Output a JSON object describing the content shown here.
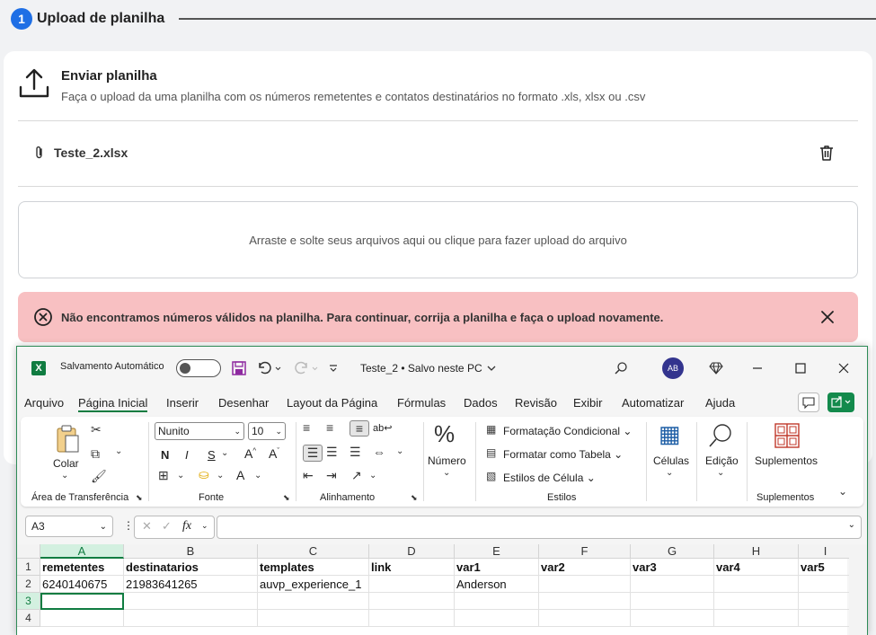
{
  "step": {
    "number": "1",
    "title": "Upload de planilha"
  },
  "upload": {
    "title": "Enviar planilha",
    "subtitle": "Faça o upload da uma planilha com os números remetentes e contatos destinatários no formato .xls, xlsx ou .csv",
    "file_name": "Teste_2.xlsx",
    "dropzone_text": "Arraste e solte seus arquivos aqui ou clique para fazer upload do arquivo"
  },
  "alert": {
    "text": "Não encontramos números válidos na planilha. Para continuar, corrija a planilha e faça o upload novamente.",
    "color": "#f8c0c2"
  },
  "excel": {
    "autosave_label": "Salvamento Automático",
    "doc_title": "Teste_2 • Salvo neste PC",
    "avatar_initials": "AB",
    "menu": [
      "Arquivo",
      "Página Inicial",
      "Inserir",
      "Desenhar",
      "Layout da Página",
      "Fórmulas",
      "Dados",
      "Revisão",
      "Exibir",
      "Automatizar",
      "Ajuda"
    ],
    "active_menu": "Página Inicial",
    "ribbon": {
      "clipboard": {
        "paste": "Colar",
        "group": "Área de Transferência"
      },
      "font": {
        "name": "Nunito",
        "size": "10",
        "bold": "N",
        "italic": "I",
        "underline": "S",
        "group": "Fonte"
      },
      "alignment": {
        "group": "Alinhamento"
      },
      "number": {
        "label": "Número"
      },
      "styles": {
        "conditional": "Formatação Condicional",
        "as_table": "Formatar como Tabela",
        "cell_styles": "Estilos de Célula",
        "group": "Estilos"
      },
      "cells": {
        "label": "Células"
      },
      "editing": {
        "label": "Edição"
      },
      "addins": {
        "label": "Suplementos",
        "group": "Suplementos"
      }
    },
    "name_box": "A3",
    "columns": [
      "A",
      "B",
      "C",
      "D",
      "E",
      "F",
      "G",
      "H",
      "I"
    ],
    "rows": [
      "1",
      "2",
      "3",
      "4"
    ],
    "cells": [
      [
        "remetentes",
        "destinatarios",
        "templates",
        "link",
        "var1",
        "var2",
        "var3",
        "var4",
        "var5"
      ],
      [
        "6240140675",
        "21983641265",
        "auvp_experience_1",
        "",
        "Anderson",
        "",
        "",
        "",
        ""
      ],
      [
        "",
        "",
        "",
        "",
        "",
        "",
        "",
        "",
        ""
      ],
      [
        "",
        "",
        "",
        "",
        "",
        "",
        "",
        "",
        ""
      ]
    ],
    "accent_color": "#107c41"
  }
}
